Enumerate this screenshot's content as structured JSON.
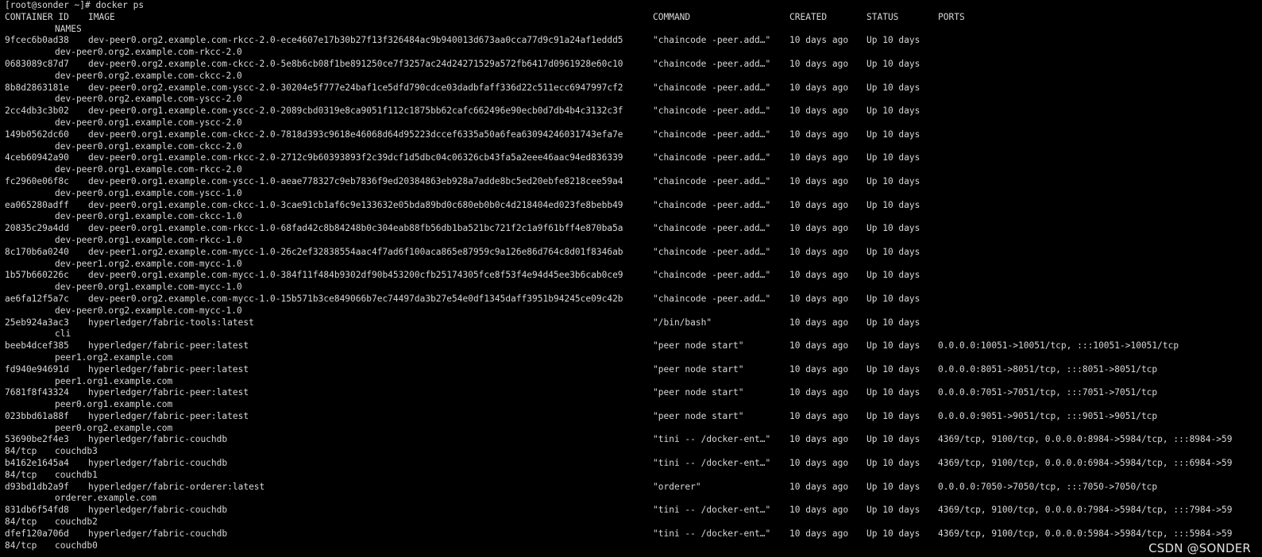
{
  "terminal": {
    "prompt": "[root@sonder ~]# docker ps",
    "headers": {
      "container_id": "CONTAINER ID",
      "image": "IMAGE",
      "command": "COMMAND",
      "created": "CREATED",
      "status": "STATUS",
      "ports": "PORTS",
      "names": "NAMES"
    },
    "rows": [
      {
        "id": "9fcec6b0ad38",
        "image": "dev-peer0.org2.example.com-rkcc-2.0-ece4607e17b30b27f13f326484ac9b940013d673aa0cca77d9c91a24af1eddd5",
        "command": "\"chaincode -peer.add…\"",
        "created": "10 days ago",
        "status": "Up 10 days",
        "ports": "",
        "name": "dev-peer0.org2.example.com-rkcc-2.0",
        "ports_wrap": ""
      },
      {
        "id": "0683089c87d7",
        "image": "dev-peer0.org2.example.com-ckcc-2.0-5e8b6cb08f1be891250ce7f3257ac24d24271529a572fb6417d0961928e60c10",
        "command": "\"chaincode -peer.add…\"",
        "created": "10 days ago",
        "status": "Up 10 days",
        "ports": "",
        "name": "dev-peer0.org2.example.com-ckcc-2.0",
        "ports_wrap": ""
      },
      {
        "id": "8b8d2863181e",
        "image": "dev-peer0.org2.example.com-yscc-2.0-30204e5f777e24baf1ce5dfd790cdce03dadbfaff336d22c511ecc6947997cf2",
        "command": "\"chaincode -peer.add…\"",
        "created": "10 days ago",
        "status": "Up 10 days",
        "ports": "",
        "name": "dev-peer0.org2.example.com-yscc-2.0",
        "ports_wrap": ""
      },
      {
        "id": "2cc4db3c3b02",
        "image": "dev-peer0.org1.example.com-yscc-2.0-2089cbd0319e8ca9051f112c1875bb62cafc662496e90ecb0d7db4b4c3132c3f",
        "command": "\"chaincode -peer.add…\"",
        "created": "10 days ago",
        "status": "Up 10 days",
        "ports": "",
        "name": "dev-peer0.org1.example.com-yscc-2.0",
        "ports_wrap": ""
      },
      {
        "id": "149b0562dc60",
        "image": "dev-peer0.org1.example.com-ckcc-2.0-7818d393c9618e46068d64d95223dccef6335a50a6fea63094246031743efa7e",
        "command": "\"chaincode -peer.add…\"",
        "created": "10 days ago",
        "status": "Up 10 days",
        "ports": "",
        "name": "dev-peer0.org1.example.com-ckcc-2.0",
        "ports_wrap": ""
      },
      {
        "id": "4ceb60942a90",
        "image": "dev-peer0.org1.example.com-rkcc-2.0-2712c9b60393893f2c39dcf1d5dbc04c06326cb43fa5a2eee46aac94ed836339",
        "command": "\"chaincode -peer.add…\"",
        "created": "10 days ago",
        "status": "Up 10 days",
        "ports": "",
        "name": "dev-peer0.org1.example.com-rkcc-2.0",
        "ports_wrap": ""
      },
      {
        "id": "fc2960e06f8c",
        "image": "dev-peer0.org1.example.com-yscc-1.0-aeae778327c9eb7836f9ed20384863eb928a7adde8bc5ed20ebfe8218cee59a4",
        "command": "\"chaincode -peer.add…\"",
        "created": "10 days ago",
        "status": "Up 10 days",
        "ports": "",
        "name": "dev-peer0.org1.example.com-yscc-1.0",
        "ports_wrap": ""
      },
      {
        "id": "ea065280adff",
        "image": "dev-peer0.org1.example.com-ckcc-1.0-3cae91cb1af6c9e133632e05bda89bd0c680eb0b0c4d218404ed023fe8bebb49",
        "command": "\"chaincode -peer.add…\"",
        "created": "10 days ago",
        "status": "Up 10 days",
        "ports": "",
        "name": "dev-peer0.org1.example.com-ckcc-1.0",
        "ports_wrap": ""
      },
      {
        "id": "20835c29a4dd",
        "image": "dev-peer0.org1.example.com-rkcc-1.0-68fad42c8b84248b0c304eab88fb56db1ba521bc721f2c1a9f61bff4e870ba5a",
        "command": "\"chaincode -peer.add…\"",
        "created": "10 days ago",
        "status": "Up 10 days",
        "ports": "",
        "name": "dev-peer0.org1.example.com-rkcc-1.0",
        "ports_wrap": ""
      },
      {
        "id": "8c170b6a0240",
        "image": "dev-peer1.org2.example.com-mycc-1.0-26c2ef32838554aac4f7ad6f100aca865e87959c9a126e86d764c8d01f8346ab",
        "command": "\"chaincode -peer.add…\"",
        "created": "10 days ago",
        "status": "Up 10 days",
        "ports": "",
        "name": "dev-peer1.org2.example.com-mycc-1.0",
        "ports_wrap": ""
      },
      {
        "id": "1b57b660226c",
        "image": "dev-peer0.org1.example.com-mycc-1.0-384f11f484b9302df90b453200cfb25174305fce8f53f4e94d45ee3b6cab0ce9",
        "command": "\"chaincode -peer.add…\"",
        "created": "10 days ago",
        "status": "Up 10 days",
        "ports": "",
        "name": "dev-peer0.org1.example.com-mycc-1.0",
        "ports_wrap": ""
      },
      {
        "id": "ae6fa12f5a7c",
        "image": "dev-peer0.org2.example.com-mycc-1.0-15b571b3ce849066b7ec74497da3b27e54e0df1345daff3951b94245ce09c42b",
        "command": "\"chaincode -peer.add…\"",
        "created": "10 days ago",
        "status": "Up 10 days",
        "ports": "",
        "name": "dev-peer0.org2.example.com-mycc-1.0",
        "ports_wrap": ""
      },
      {
        "id": "25eb924a3ac3",
        "image": "hyperledger/fabric-tools:latest",
        "command": "\"/bin/bash\"",
        "created": "10 days ago",
        "status": "Up 10 days",
        "ports": "",
        "name": "cli",
        "ports_wrap": ""
      },
      {
        "id": "beeb4dcef385",
        "image": "hyperledger/fabric-peer:latest",
        "command": "\"peer node start\"",
        "created": "10 days ago",
        "status": "Up 10 days",
        "ports": "0.0.0.0:10051->10051/tcp, :::10051->10051/tcp",
        "name": "peer1.org2.example.com",
        "ports_wrap": ""
      },
      {
        "id": "fd940e94691d",
        "image": "hyperledger/fabric-peer:latest",
        "command": "\"peer node start\"",
        "created": "10 days ago",
        "status": "Up 10 days",
        "ports": "0.0.0.0:8051->8051/tcp, :::8051->8051/tcp",
        "name": "peer1.org1.example.com",
        "ports_wrap": ""
      },
      {
        "id": "7681f8f43324",
        "image": "hyperledger/fabric-peer:latest",
        "command": "\"peer node start\"",
        "created": "10 days ago",
        "status": "Up 10 days",
        "ports": "0.0.0.0:7051->7051/tcp, :::7051->7051/tcp",
        "name": "peer0.org1.example.com",
        "ports_wrap": ""
      },
      {
        "id": "023bbd61a88f",
        "image": "hyperledger/fabric-peer:latest",
        "command": "\"peer node start\"",
        "created": "10 days ago",
        "status": "Up 10 days",
        "ports": "0.0.0.0:9051->9051/tcp, :::9051->9051/tcp",
        "name": "peer0.org2.example.com",
        "ports_wrap": ""
      },
      {
        "id": "53690be2f4e3",
        "image": "hyperledger/fabric-couchdb",
        "command": "\"tini -- /docker-ent…\"",
        "created": "10 days ago",
        "status": "Up 10 days",
        "ports": "4369/tcp, 9100/tcp, 0.0.0.0:8984->5984/tcp, :::8984->59",
        "name": "couchdb3",
        "ports_wrap": "84/tcp"
      },
      {
        "id": "b4162e1645a4",
        "image": "hyperledger/fabric-couchdb",
        "command": "\"tini -- /docker-ent…\"",
        "created": "10 days ago",
        "status": "Up 10 days",
        "ports": "4369/tcp, 9100/tcp, 0.0.0.0:6984->5984/tcp, :::6984->59",
        "name": "couchdb1",
        "ports_wrap": "84/tcp"
      },
      {
        "id": "d93bd1db2a9f",
        "image": "hyperledger/fabric-orderer:latest",
        "command": "\"orderer\"",
        "created": "10 days ago",
        "status": "Up 10 days",
        "ports": "0.0.0.0:7050->7050/tcp, :::7050->7050/tcp",
        "name": "orderer.example.com",
        "ports_wrap": ""
      },
      {
        "id": "831db6f54fd8",
        "image": "hyperledger/fabric-couchdb",
        "command": "\"tini -- /docker-ent…\"",
        "created": "10 days ago",
        "status": "Up 10 days",
        "ports": "4369/tcp, 9100/tcp, 0.0.0.0:7984->5984/tcp, :::7984->59",
        "name": "couchdb2",
        "ports_wrap": "84/tcp"
      },
      {
        "id": "dfef120a706d",
        "image": "hyperledger/fabric-couchdb",
        "command": "\"tini -- /docker-ent…\"",
        "created": "10 days ago",
        "status": "Up 10 days",
        "ports": "4369/tcp, 9100/tcp, 0.0.0.0:5984->5984/tcp, :::5984->59",
        "name": "couchdb0",
        "ports_wrap": "84/tcp"
      }
    ]
  },
  "watermark": "CSDN @SONDER",
  "colors": {
    "background": "#000000",
    "text": "#d8d8d8",
    "watermark": "#ffffff"
  }
}
